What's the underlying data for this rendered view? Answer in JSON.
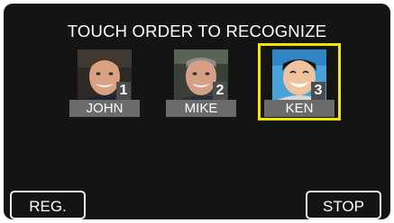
{
  "screen": {
    "title": "TOUCH ORDER TO RECOGNIZE"
  },
  "faces": [
    {
      "name": "JOHN",
      "order": "1",
      "selected": false
    },
    {
      "name": "MIKE",
      "order": "2",
      "selected": false
    },
    {
      "name": "KEN",
      "order": "3",
      "selected": true
    }
  ],
  "buttons": {
    "reg_label": "REG.",
    "stop_label": "STOP"
  },
  "colors": {
    "screen_bg": "#141414",
    "selection_highlight": "#f2e600",
    "name_bar": "#6b6b6b"
  }
}
